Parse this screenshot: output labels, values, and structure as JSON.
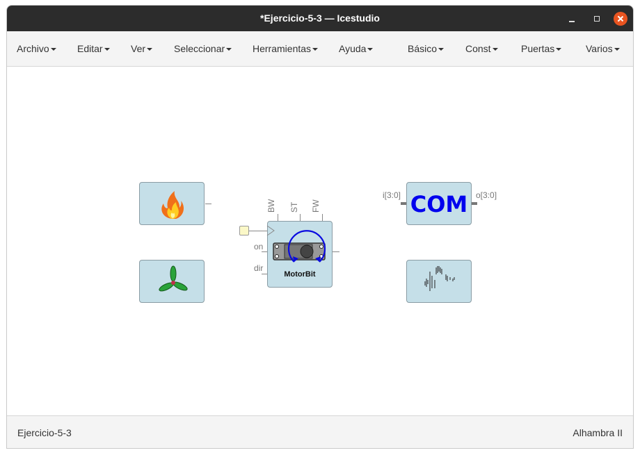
{
  "window": {
    "title": "*Ejercicio-5-3 — Icestudio"
  },
  "menubar": {
    "items": [
      "Archivo",
      "Editar",
      "Ver",
      "Seleccionar",
      "Herramientas",
      "Ayuda",
      "Básico",
      "Const",
      "Puertas",
      "Varios"
    ]
  },
  "blocks": {
    "com": {
      "text": "COM",
      "input_label": "i[3:0]",
      "output_label": "o[3:0]"
    },
    "motor": {
      "name": "MotorBit",
      "top_labels": [
        "BW",
        "ST",
        "FW"
      ],
      "left_labels": [
        "on",
        "dir"
      ]
    }
  },
  "status": {
    "left": "Ejercicio-5-3",
    "right": "Alhambra II"
  },
  "colors": {
    "titlebar": "#2c2c2c",
    "block_fill": "#c5dfe8",
    "close_button": "#e95420",
    "com_text": "#0000ee"
  }
}
